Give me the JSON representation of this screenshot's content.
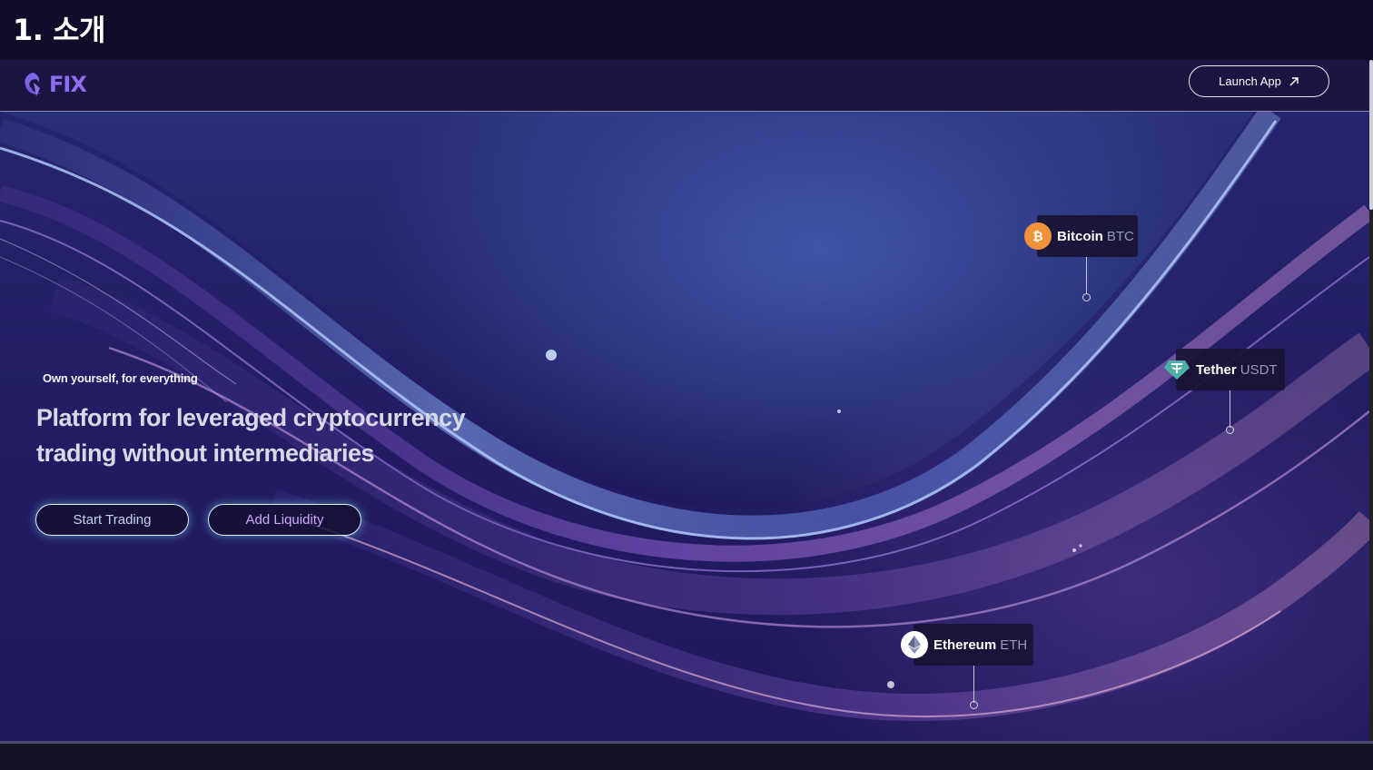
{
  "slide": {
    "title": "1. 소개"
  },
  "nav": {
    "logo_text": "FIX",
    "launch_label": "Launch App"
  },
  "hero": {
    "tagline": "Own yourself, for everything",
    "headline": "Platform for leveraged cryptocurrency trading without intermediaries",
    "start_label": "Start Trading",
    "liquidity_label": "Add Liquidity"
  },
  "coins": [
    {
      "name": "Bitcoin",
      "symbol": "BTC",
      "icon": "bitcoin-icon",
      "color": "#f0923a"
    },
    {
      "name": "Tether",
      "symbol": "USDT",
      "icon": "tether-icon",
      "color": "#4fb1a6"
    },
    {
      "name": "Ethereum",
      "symbol": "ETH",
      "icon": "ethereum-icon",
      "color": "#ffffff"
    }
  ],
  "colors": {
    "background": "#100c2a",
    "accent": "#8d6cf0",
    "cta_glow": "#78dcff"
  }
}
